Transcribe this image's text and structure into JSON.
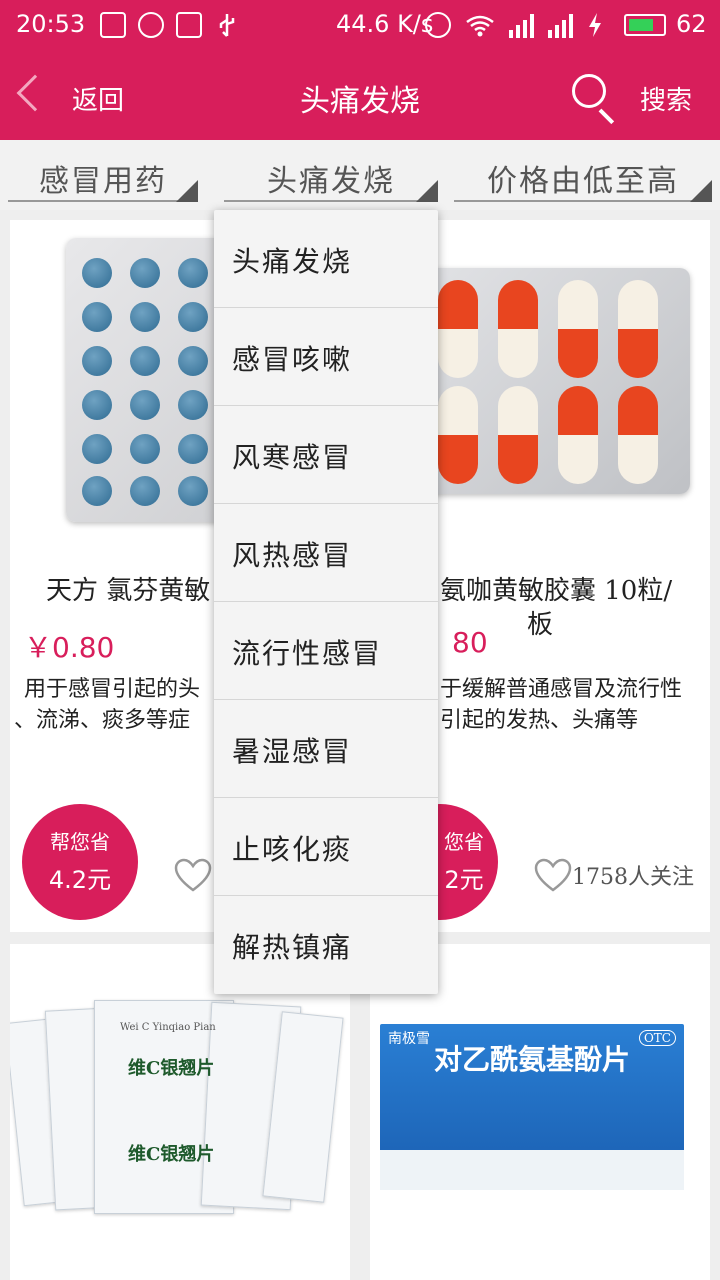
{
  "status_bar": {
    "time": "20:53",
    "network_speed": "44.6 K/s",
    "battery_level": "62"
  },
  "header": {
    "back_label": "返回",
    "title": "头痛发烧",
    "search_label": "搜索",
    "accent_color": "#d81e5b"
  },
  "filters": {
    "category": "感冒用药",
    "subcategory": "头痛发烧",
    "sort": "价格由低至高"
  },
  "dropdown": {
    "options": [
      "头痛发烧",
      "感冒咳嗽",
      "风寒感冒",
      "风热感冒",
      "流行性感冒",
      "暑湿感冒",
      "止咳化痰",
      "解热镇痛"
    ]
  },
  "products": [
    {
      "name": "天方 氯芬黄敏",
      "price": "￥0.80",
      "desc_line1": "用于感冒引起的头",
      "desc_line2": "、流涕、痰多等症",
      "save_line1": "帮您省",
      "save_line2": "4.2元",
      "icon": "heart-outline"
    },
    {
      "name_line1": "氨咖黄敏胶囊 10粒/",
      "name_line2": "板",
      "price": "80",
      "desc_line1": "于缓解普通感冒及流行性",
      "desc_line2": "引起的发热、头痛等",
      "save_line1": "您省",
      "save_line2": "2元",
      "follow": "1758人关注",
      "icon": "heart-outline"
    }
  ],
  "lower_products": [
    {
      "pack_text": "维C银翘片",
      "pack_subtext": "Wei C Yinqiao Pian"
    },
    {
      "box_brand": "南极雪",
      "box_title": "对乙酰氨基酚片",
      "box_badge": "OTC"
    }
  ]
}
